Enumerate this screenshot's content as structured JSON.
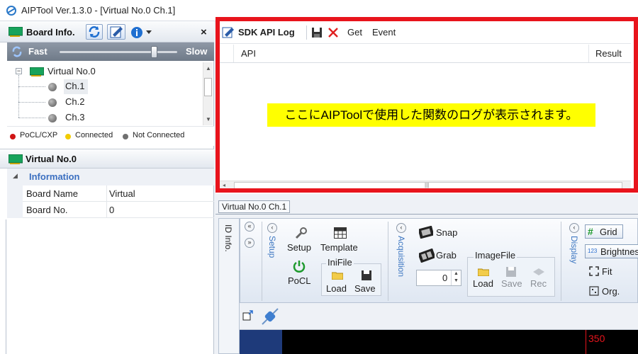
{
  "window": {
    "title": "AIPTool Ver.1.3.0 - [Virtual No.0 Ch.1]",
    "icon": "aiptool-app-icon"
  },
  "board_panel": {
    "title": "Board Info.",
    "close_label": "×",
    "speed": {
      "fast_label": "Fast",
      "slow_label": "Slow",
      "level": 0.8
    },
    "tree": {
      "root": "Virtual No.0",
      "expander": "−",
      "channels": [
        "Ch.1",
        "Ch.2",
        "Ch.3"
      ],
      "selected_channel": "Ch.1"
    },
    "legend": [
      {
        "label": "PoCL/CXP",
        "color": "#d01414"
      },
      {
        "label": "Connected",
        "color": "#f2cc00"
      },
      {
        "label": "Not Connected",
        "color": "#707070"
      }
    ]
  },
  "property_panel": {
    "title": "Virtual No.0",
    "section": "Information",
    "rows": [
      {
        "name": "Board Name",
        "value": "Virtual"
      },
      {
        "name": "Board No.",
        "value": "0"
      }
    ]
  },
  "log_panel": {
    "title": "SDK API Log",
    "get_label": "Get",
    "event_label": "Event",
    "columns": [
      "API",
      "Result"
    ],
    "message": "ここにAIPToolで使用した関数のログが表示されます。",
    "highlight_color": "#e8141c"
  },
  "document": {
    "tab_label": "Virtual No.0 Ch.1",
    "side_tab_label": "ID Info.",
    "ribbon": {
      "setup": {
        "group_label": "Setup",
        "setup_label": "Setup",
        "template_label": "Template",
        "pocl_label": "PoCL",
        "inifile": {
          "label": "IniFile",
          "load_label": "Load",
          "save_label": "Save"
        }
      },
      "acquisition": {
        "group_label": "Acquisition",
        "snap_label": "Snap",
        "grab_label": "Grab",
        "count_value": "0",
        "imagefile": {
          "label": "ImageFile",
          "load_label": "Load",
          "save_label": "Save",
          "rec_label": "Rec"
        }
      },
      "display": {
        "group_label": "Display",
        "grid_label": "Grid",
        "brightness_label": "Brightnes",
        "fit_label": "Fit",
        "org_label": "Org."
      }
    },
    "ruler_value": "350"
  }
}
